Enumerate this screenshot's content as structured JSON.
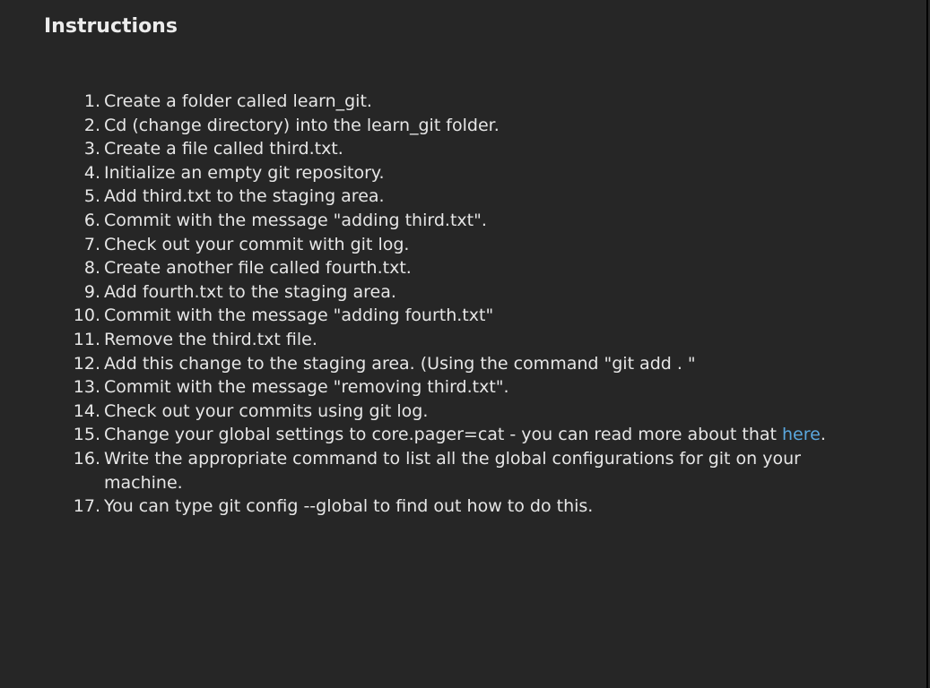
{
  "title": "Instructions",
  "steps": [
    {
      "num": "1.",
      "text": "Create a folder called learn_git."
    },
    {
      "num": "2.",
      "text": "Cd (change directory) into the learn_git folder."
    },
    {
      "num": "3.",
      "text": "Create a file called third.txt."
    },
    {
      "num": "4.",
      "text": "Initialize an empty git repository."
    },
    {
      "num": "5.",
      "text": "Add third.txt to the staging area."
    },
    {
      "num": "6.",
      "text": "Commit with the message \"adding third.txt\"."
    },
    {
      "num": "7.",
      "text": "Check out your commit with git log."
    },
    {
      "num": "8.",
      "text": "Create another file called fourth.txt."
    },
    {
      "num": "9.",
      "text": "Add fourth.txt to the staging area."
    },
    {
      "num": "10.",
      "text": "Commit with the message \"adding fourth.txt\""
    },
    {
      "num": "11.",
      "text": "Remove the third.txt file."
    },
    {
      "num": "12.",
      "text": "Add this change to the staging area. (Using the command \"git add . \""
    },
    {
      "num": "13.",
      "text": "Commit with the message \"removing third.txt\"."
    },
    {
      "num": "14.",
      "text": "Check out your commits using git log."
    },
    {
      "num": "15.",
      "text": "Change your global settings to core.pager=cat - you can read more about that ",
      "link": "here",
      "after": "."
    },
    {
      "num": "16.",
      "text": "Write the appropriate command to list all the global configurations for git on your machine."
    },
    {
      "num": "17.",
      "text": "You can type git config --global to find out how to do this."
    }
  ],
  "colors": {
    "background": "#262626",
    "text": "#e6e6e6",
    "link": "#5aa7de"
  }
}
